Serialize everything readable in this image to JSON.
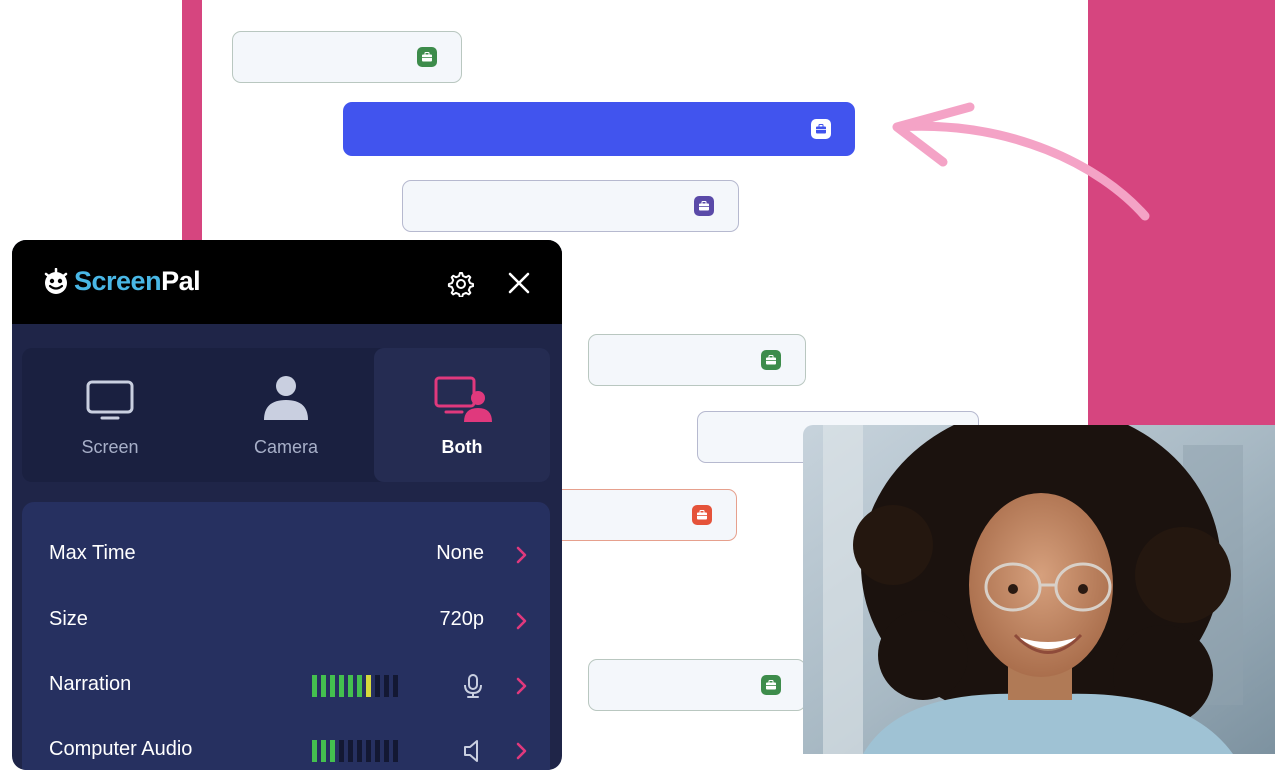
{
  "app": {
    "logo_part1": "Screen",
    "logo_part2": "Pal"
  },
  "header": {
    "settings_icon": "gear-icon",
    "close_icon": "close-icon"
  },
  "modes": [
    {
      "label": "Screen",
      "icon": "monitor-icon",
      "selected": false
    },
    {
      "label": "Camera",
      "icon": "person-icon",
      "selected": false
    },
    {
      "label": "Both",
      "icon": "monitor-person-icon",
      "selected": true
    }
  ],
  "settings": [
    {
      "label": "Max Time",
      "value": "None"
    },
    {
      "label": "Size",
      "value": "720p"
    },
    {
      "label": "Narration",
      "value": "",
      "meter_level": 0.7,
      "meter_bars": 10,
      "icon": "microphone-icon"
    },
    {
      "label": "Computer Audio",
      "value": "",
      "meter_level": 0.3,
      "meter_bars": 10,
      "icon": "speaker-icon"
    }
  ],
  "colors": {
    "brand_pink": "#d6457f",
    "active_bar": "#4154ee",
    "panel_bg": "#1f2548",
    "logo_blue": "#49b7e6",
    "chevron_pink": "#e0397d",
    "meter_green": "#44c04f",
    "meter_yellow": "#d7d93c",
    "chip_green": "#3d8c4b",
    "chip_purple": "#5a4aa8",
    "chip_red": "#e5533a"
  },
  "gantt_chips": [
    "briefcase-icon-green",
    "briefcase-icon-white",
    "briefcase-icon-purple",
    "briefcase-icon-green",
    "briefcase-icon-none",
    "briefcase-icon-red",
    "briefcase-icon-green"
  ],
  "photo": {
    "subject": "webcam-feed"
  }
}
